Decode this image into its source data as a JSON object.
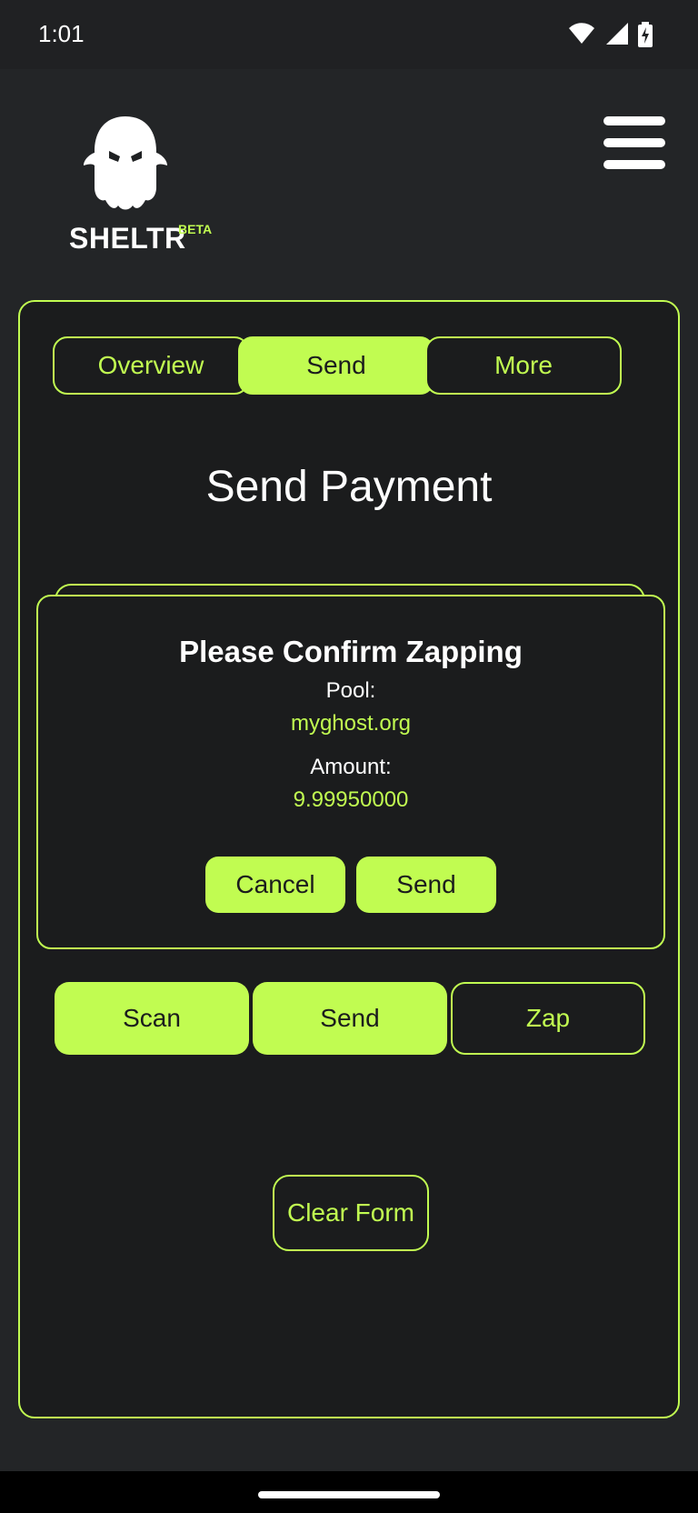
{
  "status_bar": {
    "time": "1:01",
    "icons": [
      "wifi-icon",
      "signal-icon",
      "battery-charging-icon"
    ]
  },
  "app": {
    "logo_text": "SHELTR",
    "logo_badge": "BETA",
    "menu_icon": "hamburger-menu-icon"
  },
  "tabs": [
    {
      "label": "Overview",
      "active": false
    },
    {
      "label": "Send",
      "active": true
    },
    {
      "label": "More",
      "active": false
    }
  ],
  "page": {
    "title": "Send Payment"
  },
  "modal": {
    "title": "Please Confirm Zapping",
    "pool_label": "Pool:",
    "pool_value": "myghost.org",
    "amount_label": "Amount:",
    "amount_value": "9.99950000",
    "cancel_label": "Cancel",
    "send_label": "Send"
  },
  "actions": [
    {
      "label": "Scan",
      "style": "filled"
    },
    {
      "label": "Send",
      "style": "filled"
    },
    {
      "label": "Zap",
      "style": "outline"
    }
  ],
  "clear_form_label": "Clear Form",
  "colors": {
    "accent": "#c1fc51",
    "background": "#232527",
    "card": "#1b1c1d",
    "text": "#ffffff"
  }
}
